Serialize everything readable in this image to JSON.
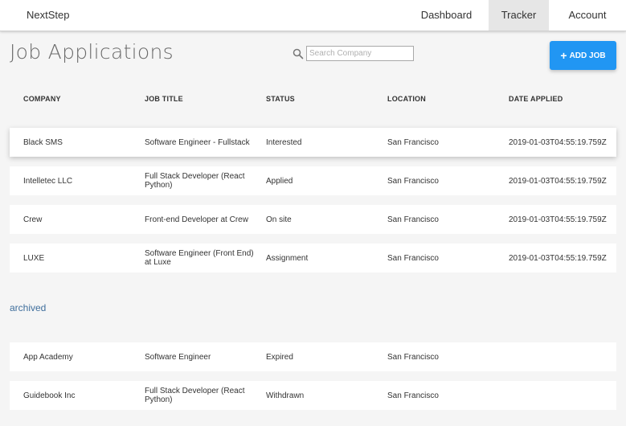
{
  "app": {
    "brand": "NextStep"
  },
  "nav": {
    "dashboard": "Dashboard",
    "tracker": "Tracker",
    "account": "Account"
  },
  "page": {
    "title": "Job Applications"
  },
  "search": {
    "placeholder": "Search Company",
    "value": ""
  },
  "add_button": {
    "label": "ADD JOB",
    "icon": "plus-icon"
  },
  "table": {
    "headers": [
      "COMPANY",
      "JOB TITLE",
      "STATUS",
      "LOCATION",
      "DATE APPLIED"
    ],
    "active_rows": [
      {
        "company": "Black SMS",
        "title": "Software Engineer - Fullstack",
        "status": "Interested",
        "location": "San Francisco",
        "date": "2019-01-03T04:55:19.759Z"
      },
      {
        "company": "Intelletec LLC",
        "title": "Full Stack Developer (React Python)",
        "status": "Applied",
        "location": "San Francisco",
        "date": "2019-01-03T04:55:19.759Z"
      },
      {
        "company": "Crew",
        "title": "Front-end Developer at Crew",
        "status": "On site",
        "location": "San Francisco",
        "date": "2019-01-03T04:55:19.759Z"
      },
      {
        "company": "LUXE",
        "title": "Software Engineer (Front End) at Luxe",
        "status": "Assignment",
        "location": "San Francisco",
        "date": "2019-01-03T04:55:19.759Z"
      }
    ],
    "archived_label": "archived",
    "archived_rows": [
      {
        "company": "App Academy",
        "title": "Software Engineer",
        "status": "Expired",
        "location": "San Francisco",
        "date": ""
      },
      {
        "company": "Guidebook Inc",
        "title": "Full Stack Developer (React Python)",
        "status": "Withdrawn",
        "location": "San Francisco",
        "date": ""
      }
    ]
  },
  "colors": {
    "accent": "#2196f3",
    "link": "#3f6e9c",
    "nav_active": "#e6e6e6"
  }
}
